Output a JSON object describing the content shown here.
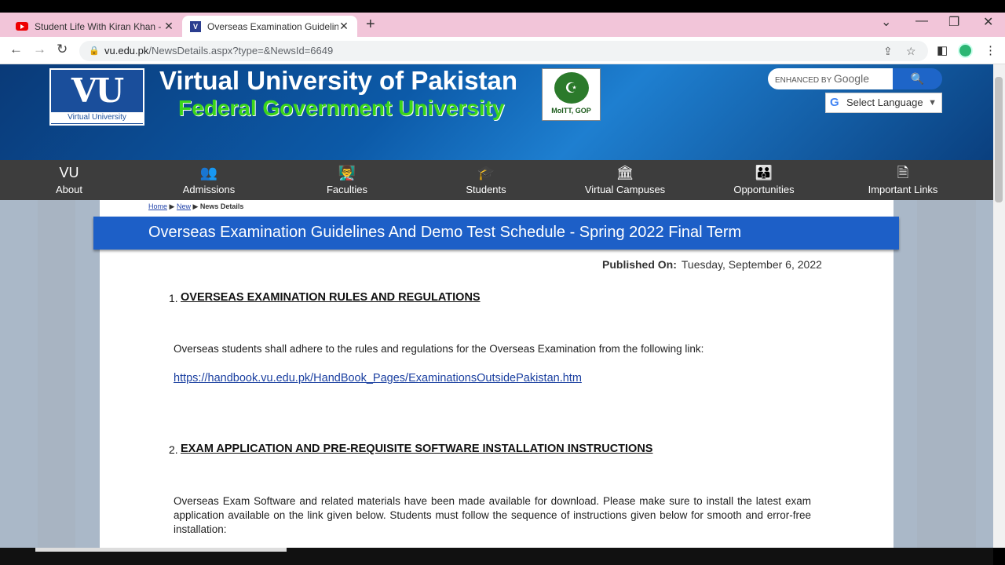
{
  "browser": {
    "tabs": [
      {
        "title": "Student Life With Kiran Khan - Yo",
        "active": false
      },
      {
        "title": "Overseas Examination Guidelines",
        "active": true
      }
    ],
    "new_tab": "+",
    "url_host": "vu.edu.pk",
    "url_path": "/NewsDetails.aspx?type=&NewsId=6649"
  },
  "header": {
    "logo_text": "VU",
    "logo_caption": "Virtual University",
    "university_name": "Virtual University of Pakistan",
    "tagline": "Federal Government University",
    "ministry_caption": "MoITT, GOP",
    "search_label": "ENHANCED BY",
    "search_brand": "Google",
    "select_language": "Select Language"
  },
  "nav": {
    "items": [
      {
        "label": "About"
      },
      {
        "label": "Admissions"
      },
      {
        "label": "Faculties"
      },
      {
        "label": "Students"
      },
      {
        "label": "Virtual Campuses"
      },
      {
        "label": "Opportunities"
      },
      {
        "label": "Important Links"
      }
    ]
  },
  "breadcrumb": {
    "home": "Home",
    "news": "New",
    "current": "News Details"
  },
  "article": {
    "title": "Overseas Examination Guidelines And Demo Test Schedule - Spring 2022 Final Term",
    "published_label": "Published On:",
    "published_date": "Tuesday, September 6, 2022",
    "section1_num": "1.",
    "section1_heading": "OVERSEAS EXAMINATION RULES AND REGULATIONS",
    "section1_text": "Overseas students shall adhere to the rules and regulations for the Overseas Examination from the following link:",
    "section1_link": "https://handbook.vu.edu.pk/HandBook_Pages/ExaminationsOutsidePakistan.htm",
    "section2_num": "2.",
    "section2_heading": "EXAM APPLICATION AND PRE-REQUISITE SOFTWARE INSTALLATION INSTRUCTIONS",
    "section2_text": "Overseas Exam Software and related materials have been made available for download. Please make sure to install the latest exam application available on the link given below. Students must follow the sequence of instructions given below for smooth and error-free installation:"
  }
}
